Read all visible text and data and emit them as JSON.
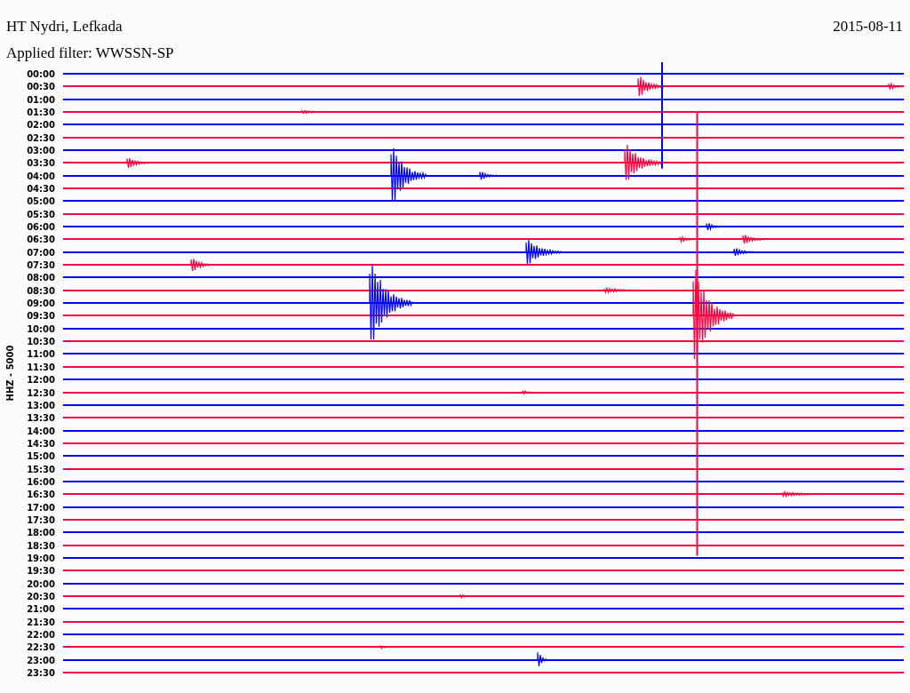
{
  "title": "HT Nydri, Lefkada",
  "date": "2015-08-11",
  "filter": "Applied filter: WWSSN-SP",
  "channel": "HHZ - 5000",
  "traces": [
    {
      "time": "00:00",
      "color": "#0000ff"
    },
    {
      "time": "00:30",
      "color": "#ff0040"
    },
    {
      "time": "01:00",
      "color": "#0000ff"
    },
    {
      "time": "01:30",
      "color": "#ff0040"
    },
    {
      "time": "02:00",
      "color": "#0000ff"
    },
    {
      "time": "02:30",
      "color": "#ff0040"
    },
    {
      "time": "03:00",
      "color": "#0000ff"
    },
    {
      "time": "03:30",
      "color": "#ff0040"
    },
    {
      "time": "04:00",
      "color": "#0000ff"
    },
    {
      "time": "04:30",
      "color": "#ff0040"
    },
    {
      "time": "05:00",
      "color": "#0000ff"
    },
    {
      "time": "05:30",
      "color": "#ff0040"
    },
    {
      "time": "06:00",
      "color": "#0000ff"
    },
    {
      "time": "06:30",
      "color": "#ff0040"
    },
    {
      "time": "07:00",
      "color": "#0000ff"
    },
    {
      "time": "07:30",
      "color": "#ff0040"
    },
    {
      "time": "08:00",
      "color": "#0000ff"
    },
    {
      "time": "08:30",
      "color": "#ff0040"
    },
    {
      "time": "09:00",
      "color": "#0000ff"
    },
    {
      "time": "09:30",
      "color": "#ff0040"
    },
    {
      "time": "10:00",
      "color": "#0000ff"
    },
    {
      "time": "10:30",
      "color": "#ff0040"
    },
    {
      "time": "11:00",
      "color": "#0000ff"
    },
    {
      "time": "11:30",
      "color": "#ff0040"
    },
    {
      "time": "12:00",
      "color": "#0000ff"
    },
    {
      "time": "12:30",
      "color": "#ff0040"
    },
    {
      "time": "13:00",
      "color": "#0000ff"
    },
    {
      "time": "13:30",
      "color": "#ff0040"
    },
    {
      "time": "14:00",
      "color": "#0000ff"
    },
    {
      "time": "14:30",
      "color": "#ff0040"
    },
    {
      "time": "15:00",
      "color": "#0000ff"
    },
    {
      "time": "15:30",
      "color": "#ff0040"
    },
    {
      "time": "16:00",
      "color": "#0000ff"
    },
    {
      "time": "16:30",
      "color": "#ff0040"
    },
    {
      "time": "17:00",
      "color": "#0000ff"
    },
    {
      "time": "17:30",
      "color": "#ff0040"
    },
    {
      "time": "18:00",
      "color": "#0000ff"
    },
    {
      "time": "18:30",
      "color": "#ff0040"
    },
    {
      "time": "19:00",
      "color": "#0000ff"
    },
    {
      "time": "19:30",
      "color": "#ff0040"
    },
    {
      "time": "20:00",
      "color": "#0000ff"
    },
    {
      "time": "20:30",
      "color": "#ff0040"
    },
    {
      "time": "21:00",
      "color": "#0000ff"
    },
    {
      "time": "21:30",
      "color": "#ff0040"
    },
    {
      "time": "22:00",
      "color": "#0000ff"
    },
    {
      "time": "22:30",
      "color": "#ff0040"
    },
    {
      "time": "23:00",
      "color": "#0000ff"
    },
    {
      "time": "23:30",
      "color": "#ff0040"
    }
  ]
}
